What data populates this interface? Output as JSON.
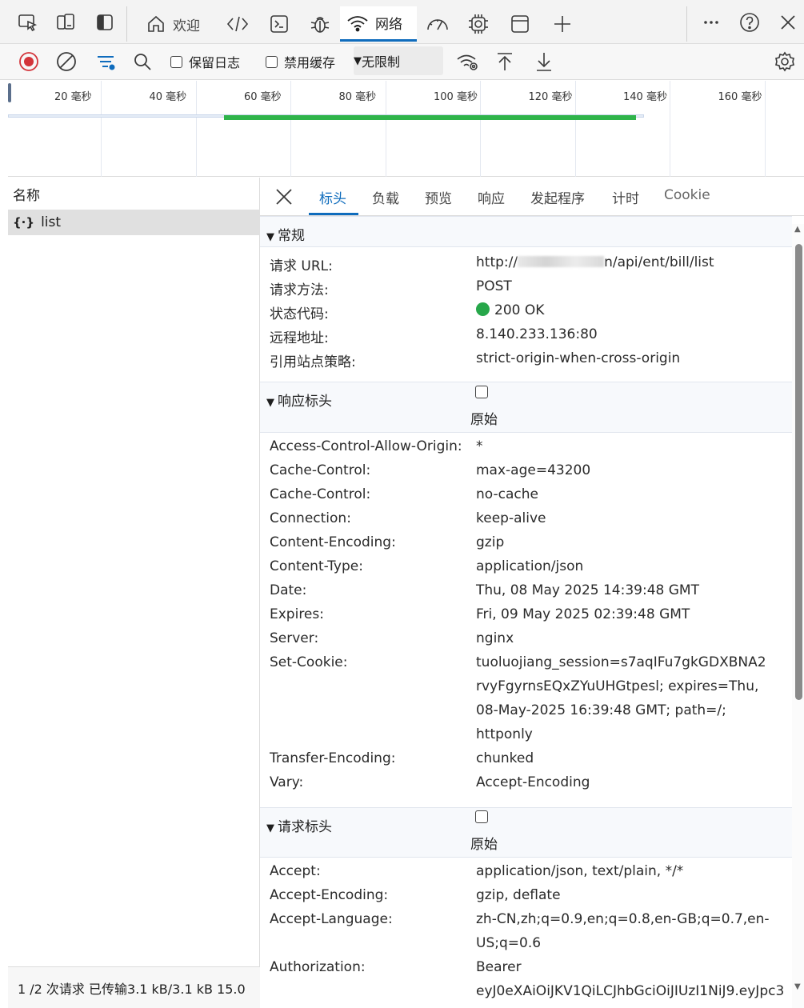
{
  "toolbar": {
    "welcome_label": "欢迎",
    "network_label": "网络"
  },
  "toolbar2": {
    "preserve_log_label": "保留日志",
    "disable_cache_label": "禁用缓存",
    "throttle_label": "无限制"
  },
  "timeline": {
    "ticks": [
      "20 毫秒",
      "40 毫秒",
      "60 毫秒",
      "80 毫秒",
      "100 毫秒",
      "120 毫秒",
      "140 毫秒",
      "160 毫秒"
    ]
  },
  "requests": {
    "header": "名称",
    "items": [
      {
        "name": "list",
        "icon": "json-icon"
      }
    ]
  },
  "status_bar": {
    "text": "1 /2 次请求  已传输3.1 kB/3.1 kB  15.0"
  },
  "details": {
    "tabs": [
      "标头",
      "负载",
      "预览",
      "响应",
      "发起程序",
      "计时",
      "Cookie"
    ],
    "active_tab": "标头",
    "general": {
      "title": "常规",
      "rows": [
        {
          "key": "请求 URL:",
          "value_prefix": "http://",
          "value_suffix": "n/api/ent/bill/list"
        },
        {
          "key": "请求方法:",
          "value": "POST"
        },
        {
          "key": "状态代码:",
          "value": "200 OK"
        },
        {
          "key": "远程地址:",
          "value": "8.140.233.136:80"
        },
        {
          "key": "引用站点策略:",
          "value": "strict-origin-when-cross-origin"
        }
      ]
    },
    "response_headers": {
      "title": "响应标头",
      "raw_label": "原始",
      "rows": [
        {
          "key": "Access-Control-Allow-Origin:",
          "value": "*"
        },
        {
          "key": "Cache-Control:",
          "value": "max-age=43200"
        },
        {
          "key": "Cache-Control:",
          "value": "no-cache"
        },
        {
          "key": "Connection:",
          "value": "keep-alive"
        },
        {
          "key": "Content-Encoding:",
          "value": "gzip"
        },
        {
          "key": "Content-Type:",
          "value": "application/json"
        },
        {
          "key": "Date:",
          "value": "Thu, 08 May 2025 14:39:48 GMT"
        },
        {
          "key": "Expires:",
          "value": "Fri, 09 May 2025 02:39:48 GMT"
        },
        {
          "key": "Server:",
          "value": "nginx"
        },
        {
          "key": "Set-Cookie:",
          "value_lines": [
            "tuoluojiang_session=s7aqIFu7gkGDXBNA2",
            "rvyFgyrnsEQxZYuUHGtpesl; expires=Thu,",
            "08-May-2025 16:39:48 GMT; path=/;",
            "httponly"
          ]
        },
        {
          "key": "Transfer-Encoding:",
          "value": "chunked"
        },
        {
          "key": "Vary:",
          "value": "Accept-Encoding"
        }
      ]
    },
    "request_headers": {
      "title": "请求标头",
      "raw_label": "原始",
      "rows": [
        {
          "key": "Accept:",
          "value": "application/json, text/plain, */*"
        },
        {
          "key": "Accept-Encoding:",
          "value": "gzip, deflate"
        },
        {
          "key": "Accept-Language:",
          "value_lines": [
            "zh-CN,zh;q=0.9,en;q=0.8,en-GB;q=0.7,en-",
            "US;q=0.6"
          ]
        },
        {
          "key": "Authorization:",
          "value_lines": [
            "Bearer",
            "eyJ0eXAiOiJKV1QiLCJhbGciOiJIUzI1NiJ9.eyJpc3"
          ]
        }
      ]
    }
  }
}
